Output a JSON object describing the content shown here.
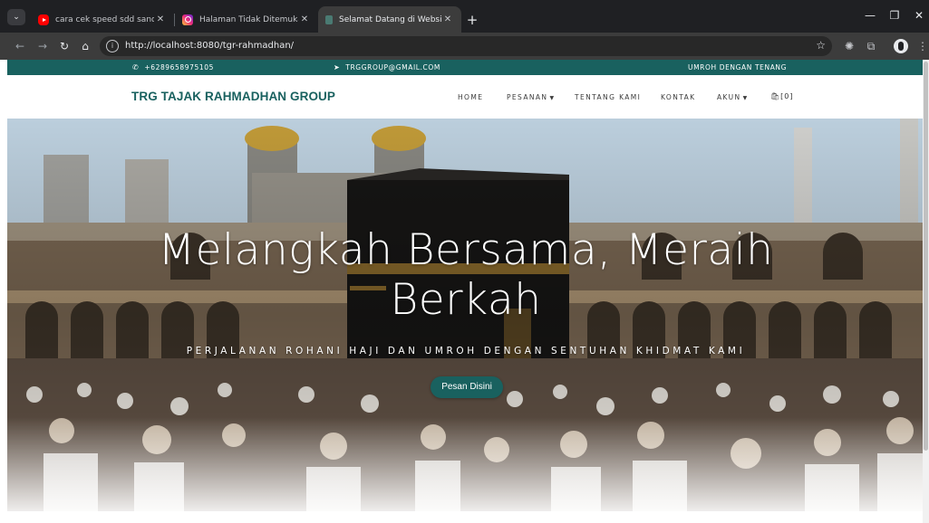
{
  "browser": {
    "tabs": [
      {
        "title": "cara cek speed sdd sandisk - Yo",
        "favicon": "youtube-icon"
      },
      {
        "title": "Halaman Tidak Ditemukan • Ins",
        "favicon": "instagram-icon"
      },
      {
        "title": "Selamat Datang di Website Tou",
        "favicon": "site-icon",
        "active": true
      }
    ],
    "url": "http://localhost:8080/tgr-rahmadhan/"
  },
  "topbar": {
    "phone": "+6289658975105",
    "email": "TRGGROUP@GMAIL.COM",
    "tagline": "UMROH DENGAN TENANG",
    "background": "#19615f"
  },
  "navbar": {
    "brand": "TRG TAJAK RAHMADHAN GROUP",
    "menu": [
      "HOME",
      "PESANAN",
      "TENTANG KAMI",
      "KONTAK",
      "AKUN"
    ],
    "cart_count": "[0]"
  },
  "hero": {
    "title_line1": "Melangkah Bersama, Meraih",
    "title_line2": "Berkah",
    "subtitle": "PERJALANAN ROHANI HAJI DAN UMROH DENGAN SENTUHAN KHIDMAT KAMI",
    "button": "Pesan Disini"
  },
  "colors": {
    "accent": "#19615f",
    "brand_text": "#19615f"
  }
}
